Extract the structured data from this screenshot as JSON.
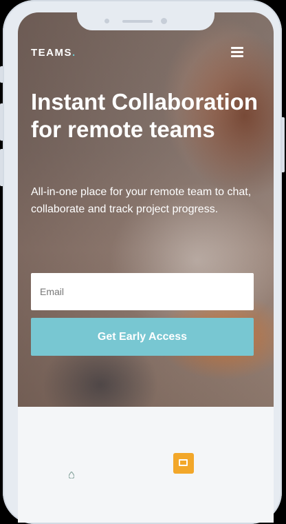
{
  "brand": {
    "logo_text": "TEAMS",
    "logo_dot": ".",
    "accent_color": "#78c7d2",
    "widget_color": "#f2a72a"
  },
  "header": {
    "menu_icon": "hamburger-menu-icon"
  },
  "hero": {
    "headline": "Instant Collaboration for remote teams",
    "subtext": "All-in-one place for your remote team to chat, collaborate and track project progress.",
    "email_placeholder": "Email",
    "email_value": "",
    "cta_label": "Get Early Access"
  },
  "footer": {
    "widget_icon": "app-widget-icon",
    "small_icon": "drop-icon"
  }
}
